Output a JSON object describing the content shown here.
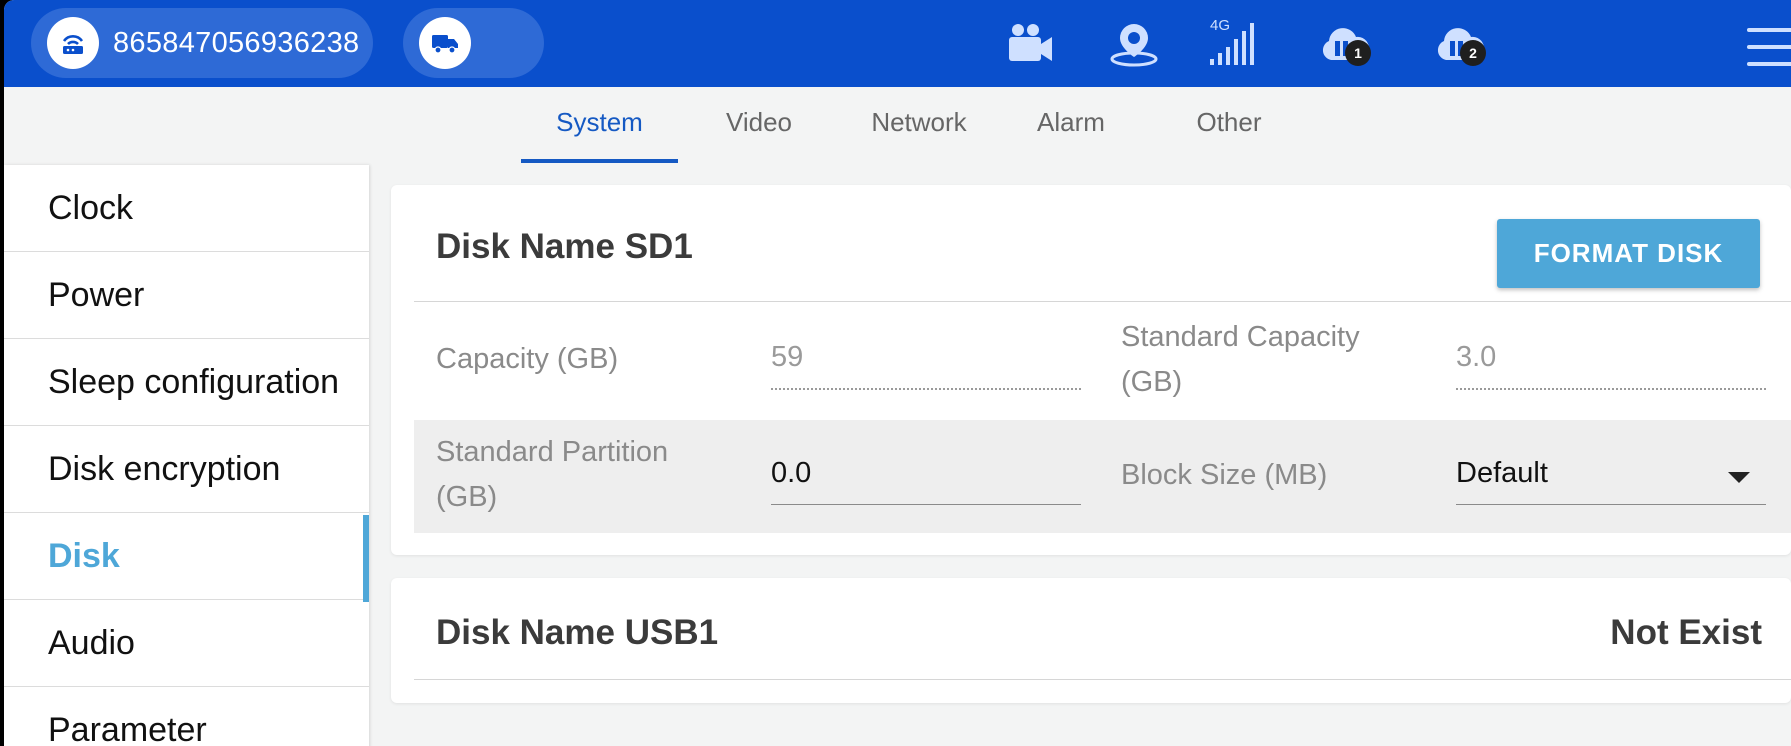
{
  "header": {
    "device_id": "865847056936238",
    "icons": [
      "router-icon",
      "truck-icon",
      "camera-icon",
      "gps-icon",
      "signal-4g-icon",
      "cloud-server-1-icon",
      "cloud-server-2-icon",
      "menu-icon"
    ],
    "signal_label": "4G",
    "cloud1_badge": "1",
    "cloud2_badge": "2",
    "bar_color": "#0a4fcc"
  },
  "tabs": [
    {
      "label": "System",
      "active": true
    },
    {
      "label": "Video"
    },
    {
      "label": "Network"
    },
    {
      "label": "Alarm"
    },
    {
      "label": "Other"
    }
  ],
  "sidebar": {
    "items": [
      {
        "label": "Clock"
      },
      {
        "label": "Power"
      },
      {
        "label": "Sleep configuration"
      },
      {
        "label": "Disk encryption"
      },
      {
        "label": "Disk",
        "active": true
      },
      {
        "label": "Audio"
      },
      {
        "label": "Parameter"
      }
    ],
    "accent_color": "#4ea7d8"
  },
  "disk_sd1": {
    "title": "Disk Name SD1",
    "format_button": "FORMAT DISK",
    "capacity_label": "Capacity (GB)",
    "capacity_value": "59",
    "std_capacity_label_1": "Standard Capacity",
    "std_capacity_label_2": "(GB)",
    "std_capacity_value": "3.0",
    "std_partition_label_1": "Standard Partition",
    "std_partition_label_2": "(GB)",
    "std_partition_value": "0.0",
    "block_size_label": "Block Size (MB)",
    "block_size_value": "Default"
  },
  "disk_usb1": {
    "title": "Disk Name USB1",
    "status": "Not Exist"
  }
}
